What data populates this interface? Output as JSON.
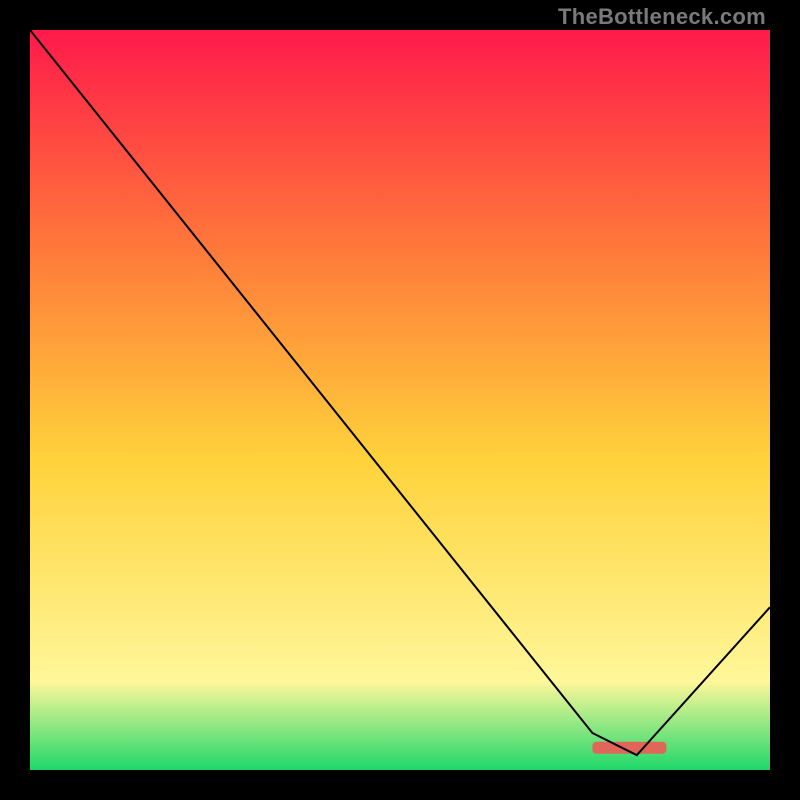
{
  "watermark": "TheBottleneck.com",
  "chart_data": {
    "type": "line",
    "title": "",
    "xlabel": "",
    "ylabel": "",
    "xlim": [
      0,
      100
    ],
    "ylim": [
      0,
      100
    ],
    "grid": false,
    "legend": false,
    "series": [
      {
        "name": "curve",
        "x": [
          0,
          20,
          76,
          82,
          100
        ],
        "values": [
          100,
          75,
          5,
          2,
          22
        ]
      }
    ],
    "annotations": [
      {
        "name": "optimum-marker",
        "shape": "rect",
        "x_range": [
          76,
          86
        ],
        "y": 3,
        "color": "#e1665a"
      }
    ],
    "background_gradient": {
      "top": "#ff1a4a",
      "mid_high": "#ff7a3a",
      "mid": "#ffd23a",
      "mid_low": "#fff79a",
      "bottom": "#1fd86a"
    }
  }
}
